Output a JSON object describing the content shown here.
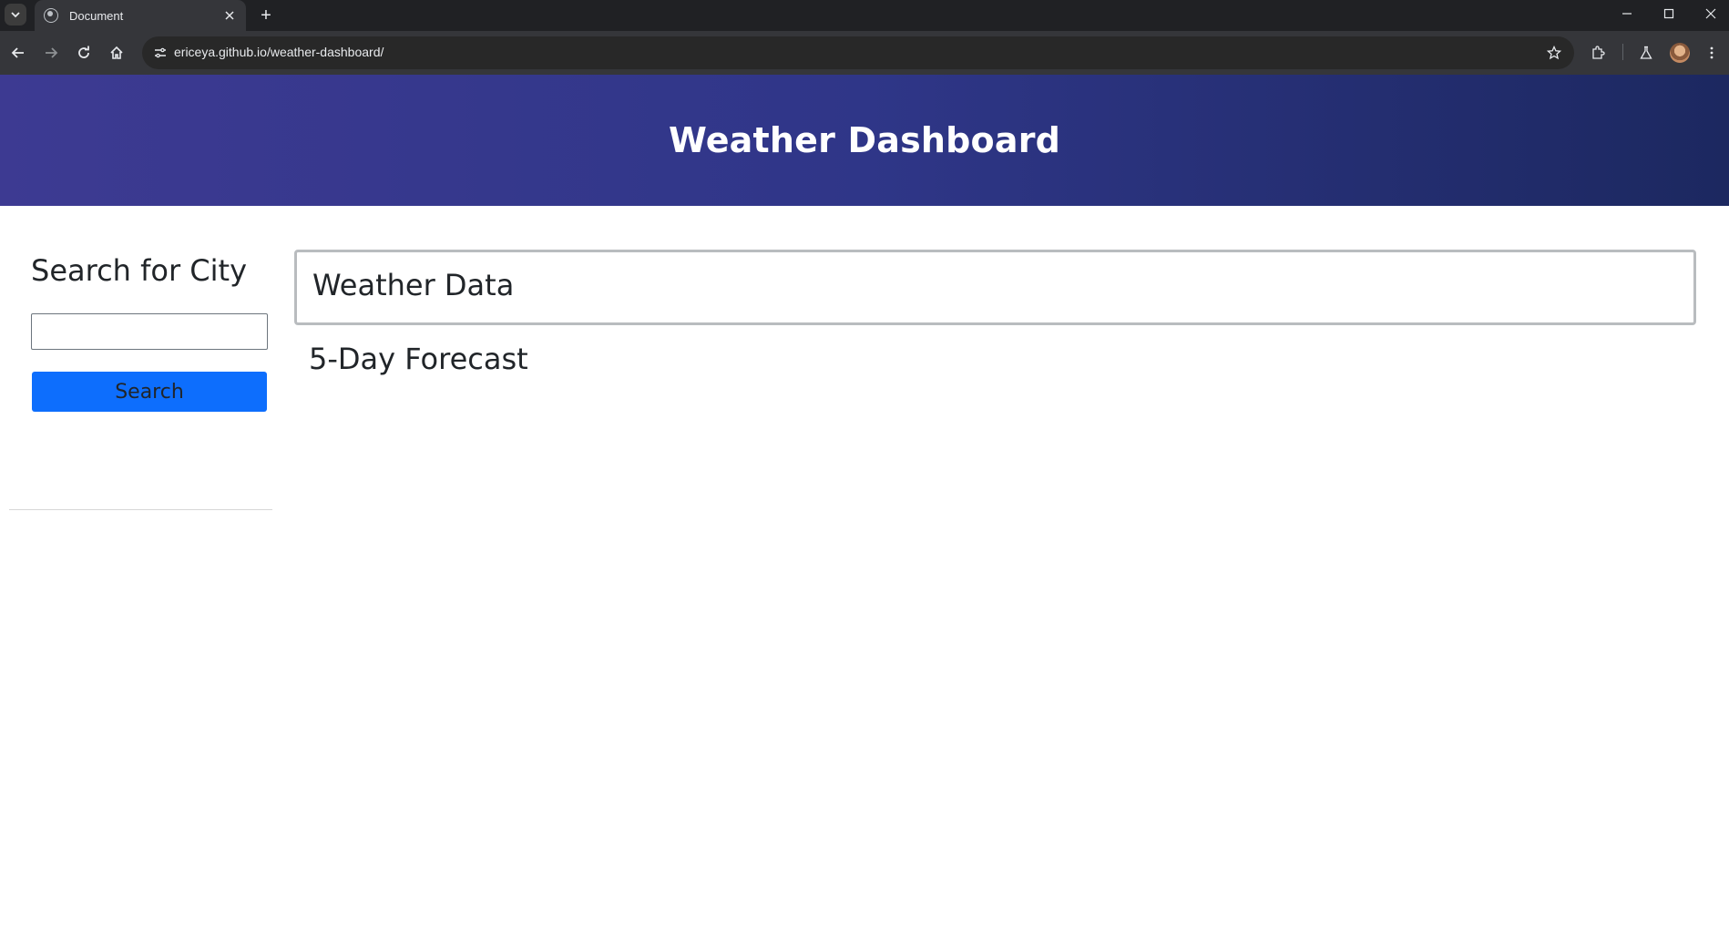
{
  "browser": {
    "tab_title": "Document",
    "url": "ericeya.github.io/weather-dashboard/",
    "new_tab_symbol": "+"
  },
  "header": {
    "title": "Weather Dashboard"
  },
  "sidebar": {
    "heading": "Search for City",
    "search_input_value": "",
    "search_button_label": "Search"
  },
  "main": {
    "weather_data_title": "Weather Data",
    "forecast_title": "5-Day Forecast"
  },
  "colors": {
    "header_gradient_start": "#3d3a92",
    "header_gradient_end": "#1c2860",
    "search_button": "#0d6efd"
  },
  "icons": [
    "tab-search-icon",
    "globe-icon",
    "close-icon",
    "minimize-icon",
    "maximize-icon",
    "back-icon",
    "forward-icon",
    "reload-icon",
    "home-icon",
    "site-info-icon",
    "star-icon",
    "extensions-icon",
    "labs-icon",
    "avatar",
    "menu-icon"
  ]
}
